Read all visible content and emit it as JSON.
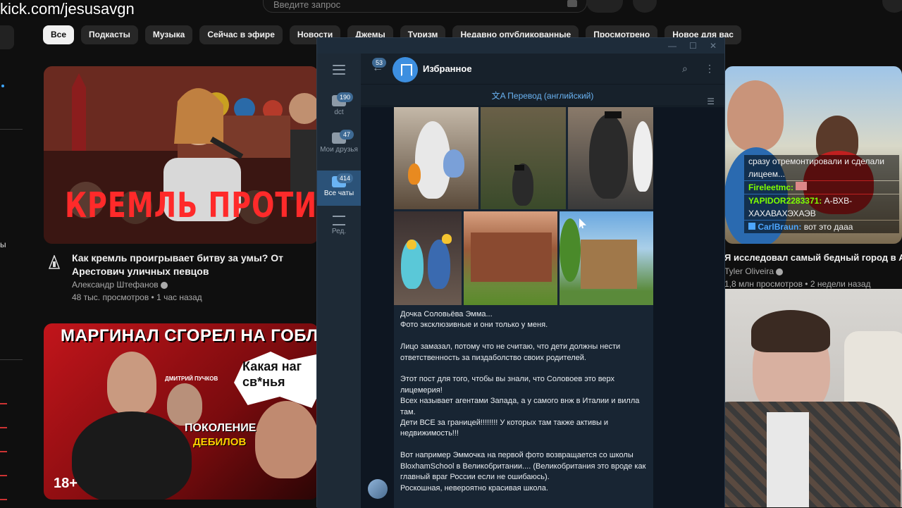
{
  "stream": {
    "url": "kick.com/jesusavgn"
  },
  "youtube": {
    "search_placeholder": "Введите запрос",
    "chips": [
      "Все",
      "Подкасты",
      "Музыка",
      "Сейчас в эфире",
      "Новости",
      "Джемы",
      "Туризм",
      "Недавно опубликованные",
      "Просмотрено",
      "Новое для вас"
    ],
    "video1": {
      "thumb_text": "КРЕМЛЬ ПРОТИВ ИДЕЙНЫ",
      "title": "Как кремль проигрывает битву за умы? От Арестович уличных певцов",
      "channel": "Александр Штефанов",
      "meta": "48 тыс. просмотров • 1 час назад"
    },
    "video2": {
      "thumb_title": "МАРГИНАЛ СГОРЕЛ НА ГОБЛ",
      "bubble": "Какая наг св*нья",
      "sub1": "ПОКОЛЕНИЕ",
      "sub2": "ДЕБИЛОВ",
      "age": "18+",
      "author_caption": "ДМИТРИЙ ПУЧКОВ"
    },
    "video3": {
      "title": "Я исследовал самый бедный город в А",
      "channel": "Tyler Oliveira",
      "meta": "1,8 млн просмотров • 2 недели назад"
    },
    "sidebar_stub": "ы"
  },
  "stream_chat": [
    {
      "user": "",
      "text": "сразу отремонтировали и сделали лицеем..."
    },
    {
      "user": "Fireleetmc:",
      "text": ""
    },
    {
      "user": "YAPIDOR2283371:",
      "text": "А-ВХВ-ХАХАВАХЭХАЭВ"
    },
    {
      "user": "CarlBraun:",
      "text": "вот это дааа"
    }
  ],
  "telegram": {
    "chat_name": "Избранное",
    "back_badge": "53",
    "translate_label": "Перевод (английский)",
    "folders": [
      {
        "label": "dct",
        "badge": "190"
      },
      {
        "label": "Мои друзья",
        "badge": "47"
      },
      {
        "label": "Все чаты",
        "badge": "414"
      },
      {
        "label": "Ред.",
        "badge": ""
      }
    ],
    "message": "Дочка Соловьёва Эмма...\nФото эксклюзивные и они только у меня.\n\nЛицо замазал, потому что не считаю, что дети должны нести ответственность за пиздаболство своих родителей.\n\nЭтот пост для того, чтобы вы знали, что Соловоев это верх лицемерия!\nВсех называет агентами Запада, а у самого внж в Италии и вилла там.\nДети ВСЕ за границей!!!!!!!! У которых там также активы и недвижимость!!!\n\nВот например Эммочка на первой фото возвращается со школы BloxhamSchool в Великобритании.... (Великобритания это вроде как главный враг России если не ошибаюсь).\nРоскошная, невероятно красивая школа."
  }
}
